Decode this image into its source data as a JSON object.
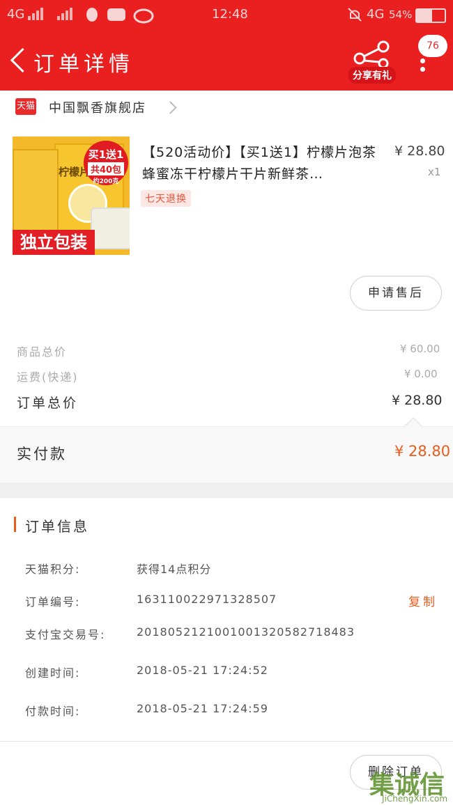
{
  "status_bar": {
    "network_left": "4G",
    "time": "12:48",
    "network_right": "4G",
    "battery": "54%"
  },
  "nav": {
    "title": "订单详情",
    "share_label": "分享有礼",
    "badge_count": "76"
  },
  "store": {
    "platform": "天猫",
    "name": "中国飘香旗舰店"
  },
  "product": {
    "title": "【520活动价】【买1送1】柠檬片泡茶蜂蜜冻干柠檬片干片新鲜茶…",
    "price": "¥ 28.80",
    "quantity": "x1",
    "return_tag": "七天退换",
    "image": {
      "box_label": "柠檬片",
      "promo_top": "买1送1",
      "promo_mid": "共40包",
      "promo_small": "约200克",
      "banner": "独立包装"
    }
  },
  "after_sale_button": "申请售后",
  "totals": {
    "goods_total_label": "商品总价",
    "goods_total_value": "¥ 60.00",
    "shipping_label": "运费(快递)",
    "shipping_value": "¥ 0.00",
    "order_total_label": "订单总价",
    "order_total_value": "¥ 28.80",
    "paid_label": "实付款",
    "paid_value": "¥ 28.80"
  },
  "order_info": {
    "section_title": "订单信息",
    "rows": [
      {
        "label": "天猫积分:",
        "value": "获得14点积分"
      },
      {
        "label": "订单编号:",
        "value": "163110022971328507"
      },
      {
        "label": "支付宝交易号:",
        "value": "2018052121001001320582718483"
      },
      {
        "label": "创建时间:",
        "value": "2018-05-21 17:24:52"
      },
      {
        "label": "付款时间:",
        "value": "2018-05-21 17:24:59"
      }
    ],
    "copy_label": "复制"
  },
  "bottom": {
    "delete_button": "删除订单"
  },
  "watermark": {
    "logo": "集诚信",
    "url": "JiChengXin.com"
  },
  "colors": {
    "header": "#ea1f20",
    "accent": "#e85d1d",
    "tag_bg": "#fde7e4"
  }
}
